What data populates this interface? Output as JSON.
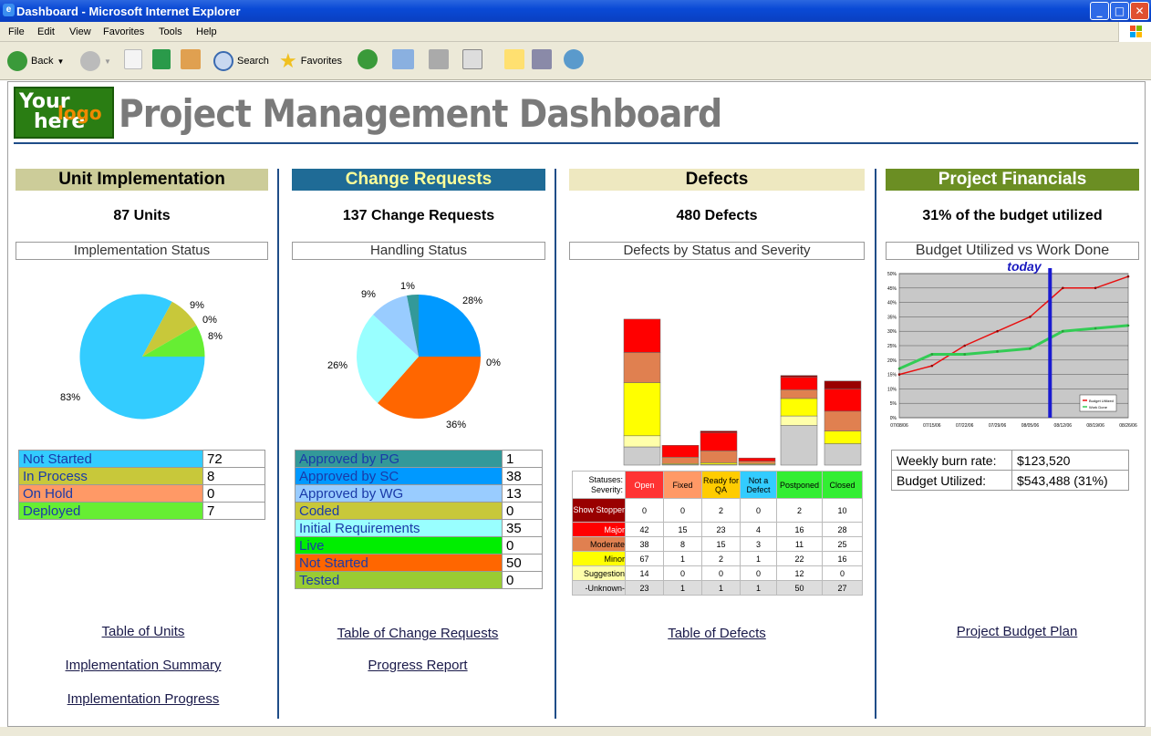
{
  "window": {
    "title": "Dashboard - Microsoft Internet Explorer"
  },
  "menu": [
    "File",
    "Edit",
    "View",
    "Favorites",
    "Tools",
    "Help"
  ],
  "toolbar": {
    "back": "Back",
    "search": "Search",
    "favorites": "Favorites"
  },
  "logo": {
    "line1": "Your",
    "line2": "here",
    "word": "logo"
  },
  "page_title": "Project Management Dashboard",
  "unit": {
    "header": "Unit Implementation",
    "count": "87 Units",
    "chart_title": "Implementation Status",
    "pie_labels": [
      "83%",
      "9%",
      "0%",
      "8%"
    ],
    "legend": [
      {
        "label": "Not Started",
        "value": "72",
        "color": "#33ccff"
      },
      {
        "label": "In Process",
        "value": "8",
        "color": "#c8c83a"
      },
      {
        "label": "On Hold",
        "value": "0",
        "color": "#ff9966"
      },
      {
        "label": "Deployed",
        "value": "7",
        "color": "#66ee33"
      }
    ],
    "links": [
      "Table of Units",
      "Implementation Summary",
      "Implementation Progress"
    ]
  },
  "change": {
    "header": "Change Requests",
    "count": "137 Change Requests",
    "chart_title": "Handling Status",
    "pie_labels": [
      "28%",
      "0%",
      "36%",
      "26%",
      "9%",
      "1%"
    ],
    "legend": [
      {
        "label": "Approved by PG",
        "value": "1",
        "color": "#339999"
      },
      {
        "label": "Approved by SC",
        "value": "38",
        "color": "#0099ff"
      },
      {
        "label": "Approved by WG",
        "value": "13",
        "color": "#99ccff"
      },
      {
        "label": "Coded",
        "value": "0",
        "color": "#c8c83a"
      },
      {
        "label": "Initial Requirements",
        "value": "35",
        "color": "#99ffff"
      },
      {
        "label": "Live",
        "value": "0",
        "color": "#00ee00"
      },
      {
        "label": "Not Started",
        "value": "50",
        "color": "#ff6600"
      },
      {
        "label": "Tested",
        "value": "0",
        "color": "#99cc33"
      }
    ],
    "links": [
      "Table of Change Requests",
      "Progress Report"
    ]
  },
  "defects": {
    "header": "Defects",
    "count": "480 Defects",
    "chart_title": "Defects by Status and Severity",
    "statuses_label": "Statuses:",
    "severity_label": "Severity:",
    "statuses": [
      {
        "name": "Open",
        "color": "#ff3333"
      },
      {
        "name": "Fixed",
        "color": "#ff9966"
      },
      {
        "name": "Ready for QA",
        "color": "#ffcc00"
      },
      {
        "name": "Not a Defect",
        "color": "#33ccff"
      },
      {
        "name": "Postponed",
        "color": "#33ee33"
      },
      {
        "name": "Closed",
        "color": "#33ee33"
      }
    ],
    "severities": [
      {
        "name": "Show Stopper",
        "color": "#990000",
        "values": [
          "0",
          "0",
          "2",
          "0",
          "2",
          "10"
        ]
      },
      {
        "name": "Major",
        "color": "#ff0000",
        "values": [
          "42",
          "15",
          "23",
          "4",
          "16",
          "28"
        ]
      },
      {
        "name": "Moderate",
        "color": "#e08050",
        "values": [
          "38",
          "8",
          "15",
          "3",
          "11",
          "25"
        ]
      },
      {
        "name": "Minor",
        "color": "#ffff00",
        "values": [
          "67",
          "1",
          "2",
          "1",
          "22",
          "16"
        ]
      },
      {
        "name": "Suggestion",
        "color": "#ffffaa",
        "values": [
          "14",
          "0",
          "0",
          "0",
          "12",
          "0"
        ]
      },
      {
        "name": "-Unknown-",
        "color": "#cccccc",
        "values": [
          "23",
          "1",
          "1",
          "1",
          "50",
          "27"
        ]
      }
    ],
    "links": [
      "Table of Defects"
    ]
  },
  "financials": {
    "header": "Project Financials",
    "count": "31% of the budget utilized",
    "chart_title": "Budget Utilized vs Work Done",
    "today_label": "today",
    "legend": [
      "Budget Utilized",
      "Work Done"
    ],
    "yticks": [
      "50%",
      "45%",
      "40%",
      "35%",
      "30%",
      "25%",
      "20%",
      "15%",
      "10%",
      "5%",
      "0%"
    ],
    "xticks": [
      "07/08/06",
      "07/15/06",
      "07/22/06",
      "07/29/06",
      "08/05/06",
      "08/12/06",
      "08/19/06",
      "08/26/06"
    ],
    "rows": [
      {
        "label": "Weekly burn rate:",
        "value": "$123,520"
      },
      {
        "label": "Budget Utilized:",
        "value": "$543,488 (31%)"
      }
    ],
    "links": [
      "Project Budget Plan"
    ]
  },
  "chart_data": [
    {
      "type": "pie",
      "title": "Implementation Status",
      "categories": [
        "Not Started",
        "In Process",
        "On Hold",
        "Deployed"
      ],
      "values": [
        72,
        8,
        0,
        7
      ]
    },
    {
      "type": "pie",
      "title": "Handling Status",
      "categories": [
        "Approved by PG",
        "Approved by SC",
        "Approved by WG",
        "Coded",
        "Initial Requirements",
        "Live",
        "Not Started",
        "Tested"
      ],
      "values": [
        1,
        38,
        13,
        0,
        35,
        0,
        50,
        0
      ]
    },
    {
      "type": "bar",
      "title": "Defects by Status and Severity",
      "categories": [
        "Open",
        "Fixed",
        "Ready for QA",
        "Not a Defect",
        "Postponed",
        "Closed"
      ],
      "series": [
        {
          "name": "Show Stopper",
          "values": [
            0,
            0,
            2,
            0,
            2,
            10
          ]
        },
        {
          "name": "Major",
          "values": [
            42,
            15,
            23,
            4,
            16,
            28
          ]
        },
        {
          "name": "Moderate",
          "values": [
            38,
            8,
            15,
            3,
            11,
            25
          ]
        },
        {
          "name": "Minor",
          "values": [
            67,
            1,
            2,
            1,
            22,
            16
          ]
        },
        {
          "name": "Suggestion",
          "values": [
            14,
            0,
            0,
            0,
            12,
            0
          ]
        },
        {
          "name": "-Unknown-",
          "values": [
            23,
            1,
            1,
            1,
            50,
            27
          ]
        }
      ]
    },
    {
      "type": "line",
      "title": "Budget Utilized vs Work Done",
      "x": [
        "07/08/06",
        "07/15/06",
        "07/22/06",
        "07/29/06",
        "08/05/06",
        "08/12/06",
        "08/19/06",
        "08/26/06"
      ],
      "ylim": [
        0,
        50
      ],
      "series": [
        {
          "name": "Budget Utilized",
          "values": [
            15,
            18,
            25,
            30,
            35,
            45,
            45,
            49
          ]
        },
        {
          "name": "Work Done",
          "values": [
            17,
            22,
            22,
            23,
            24,
            30,
            31,
            32
          ]
        }
      ]
    }
  ]
}
